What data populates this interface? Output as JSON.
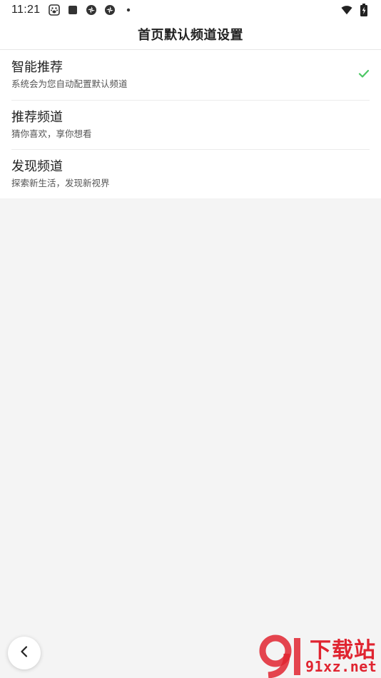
{
  "status_bar": {
    "time": "11:21",
    "left_icons": [
      "baidu-paw-icon",
      "square-icon",
      "aperture-icon",
      "aperture-icon",
      "dot-icon"
    ],
    "right_icons": [
      "wifi-icon",
      "battery-charging-icon"
    ]
  },
  "header": {
    "title": "首页默认频道设置"
  },
  "channels": [
    {
      "title": "智能推荐",
      "subtitle": "系统会为您自动配置默认频道",
      "selected": true
    },
    {
      "title": "推荐频道",
      "subtitle": "猜你喜欢，享你想看",
      "selected": false
    },
    {
      "title": "发现频道",
      "subtitle": "探索新生活，发现新视界",
      "selected": false
    }
  ],
  "colors": {
    "check": "#4cc764",
    "watermark": "#e02430",
    "background": "#f4f4f4"
  },
  "watermark": {
    "top": "下载站",
    "bottom": "91xz.net"
  }
}
